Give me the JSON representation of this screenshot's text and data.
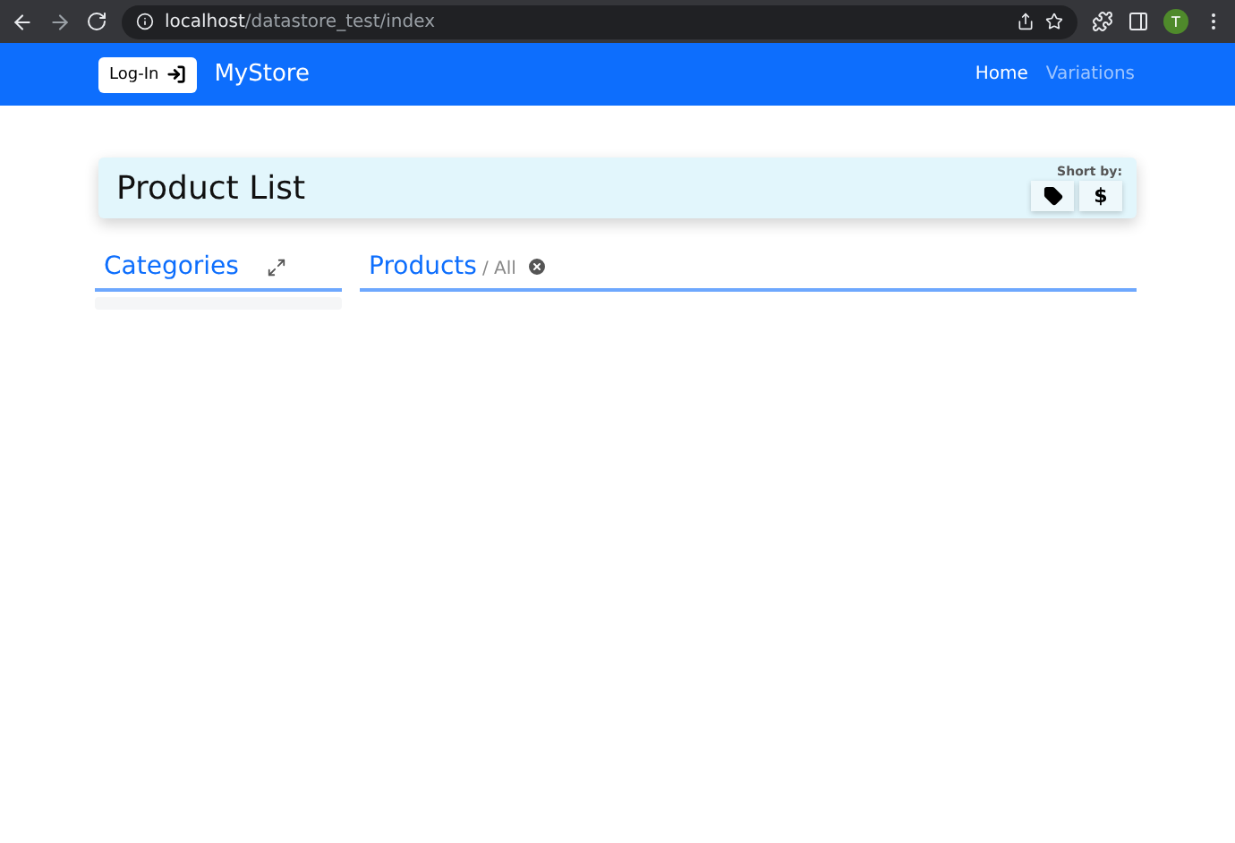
{
  "browser": {
    "url_host": "localhost",
    "url_path": "/datastore_test/index",
    "profile_initial": "T"
  },
  "navbar": {
    "login_button": "Log-In",
    "brand": "MyStore",
    "links": [
      {
        "label": "Home",
        "selected": true
      },
      {
        "label": "Variations",
        "selected": false
      }
    ]
  },
  "header": {
    "title": "Product List",
    "sort_label": "Short by:",
    "sort_buttons": [
      {
        "kind": "tag"
      },
      {
        "kind": "text",
        "label": "$"
      }
    ]
  },
  "categories": {
    "title": "Categories"
  },
  "products": {
    "title": "Products",
    "filter": "/ All"
  }
}
